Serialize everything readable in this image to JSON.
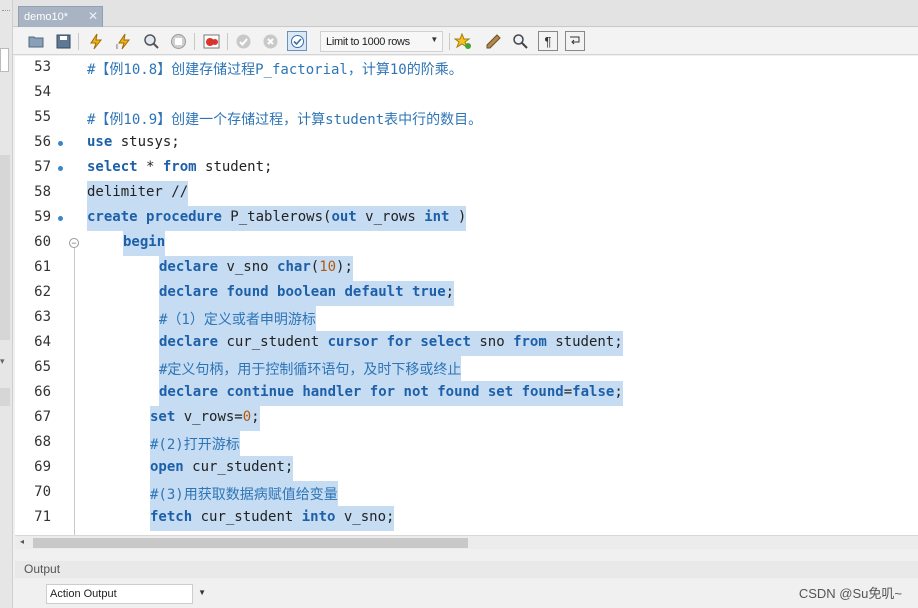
{
  "tab": {
    "title": "demo10*",
    "close": "✕"
  },
  "toolbar": {
    "limit_label": "Limit to 1000 rows",
    "limit_arrow": "▼"
  },
  "editor": {
    "lines": [
      {
        "num": "53",
        "marker": false,
        "segs": [
          {
            "t": "#【例10.8】创建存储过程P_factorial，计算10的阶乘。",
            "c": "comment"
          }
        ]
      },
      {
        "num": "54",
        "marker": false,
        "segs": []
      },
      {
        "num": "55",
        "marker": false,
        "segs": [
          {
            "t": "#【例10.9】创建一个存储过程，计算student表中行的数目。",
            "c": "comment"
          }
        ]
      },
      {
        "num": "56",
        "marker": true,
        "segs": [
          {
            "t": "use",
            "c": "kw"
          },
          {
            "t": " stusys;"
          }
        ]
      },
      {
        "num": "57",
        "marker": true,
        "segs": [
          {
            "t": "select",
            "c": "kw"
          },
          {
            "t": " * "
          },
          {
            "t": "from",
            "c": "kw"
          },
          {
            "t": " student;"
          }
        ]
      },
      {
        "num": "58",
        "marker": false,
        "sel": true,
        "segs": [
          {
            "t": "delimiter //"
          }
        ]
      },
      {
        "num": "59",
        "marker": true,
        "sel": true,
        "segs": [
          {
            "t": "create",
            "c": "kw"
          },
          {
            "t": " "
          },
          {
            "t": "procedure",
            "c": "kw"
          },
          {
            "t": " P_tablerows("
          },
          {
            "t": "out",
            "c": "kw"
          },
          {
            "t": " v_rows "
          },
          {
            "t": "int",
            "c": "kw"
          },
          {
            "t": " )"
          }
        ]
      },
      {
        "num": "60",
        "marker": false,
        "fold": true,
        "sel": true,
        "indent": 36,
        "segs": [
          {
            "t": "begin",
            "c": "kw"
          }
        ]
      },
      {
        "num": "61",
        "marker": false,
        "sel": true,
        "indent": 72,
        "segs": [
          {
            "t": "declare",
            "c": "kw"
          },
          {
            "t": " v_sno "
          },
          {
            "t": "char",
            "c": "kw"
          },
          {
            "t": "("
          },
          {
            "t": "10",
            "c": "num"
          },
          {
            "t": ");"
          }
        ]
      },
      {
        "num": "62",
        "marker": false,
        "sel": true,
        "indent": 72,
        "segs": [
          {
            "t": "declare",
            "c": "kw"
          },
          {
            "t": " "
          },
          {
            "t": "found",
            "c": "kw"
          },
          {
            "t": " "
          },
          {
            "t": "boolean",
            "c": "kw"
          },
          {
            "t": " "
          },
          {
            "t": "default",
            "c": "kw"
          },
          {
            "t": " "
          },
          {
            "t": "true",
            "c": "kw"
          },
          {
            "t": ";"
          }
        ]
      },
      {
        "num": "63",
        "marker": false,
        "sel": true,
        "indent": 72,
        "segs": [
          {
            "t": "#（1）定义或者申明游标",
            "c": "comment"
          }
        ]
      },
      {
        "num": "64",
        "marker": false,
        "sel": true,
        "indent": 72,
        "segs": [
          {
            "t": "declare",
            "c": "kw"
          },
          {
            "t": " cur_student "
          },
          {
            "t": "cursor",
            "c": "kw"
          },
          {
            "t": " "
          },
          {
            "t": "for",
            "c": "kw"
          },
          {
            "t": " "
          },
          {
            "t": "select",
            "c": "kw"
          },
          {
            "t": " sno "
          },
          {
            "t": "from",
            "c": "kw"
          },
          {
            "t": " student;"
          }
        ]
      },
      {
        "num": "65",
        "marker": false,
        "sel": true,
        "indent": 72,
        "segs": [
          {
            "t": "#定义句柄，用于控制循环语句，及时下移或终止",
            "c": "comment"
          }
        ]
      },
      {
        "num": "66",
        "marker": false,
        "sel": true,
        "indent": 72,
        "segs": [
          {
            "t": "declare",
            "c": "kw"
          },
          {
            "t": " "
          },
          {
            "t": "continue",
            "c": "kw"
          },
          {
            "t": " "
          },
          {
            "t": "handler",
            "c": "kw"
          },
          {
            "t": " "
          },
          {
            "t": "for",
            "c": "kw"
          },
          {
            "t": " "
          },
          {
            "t": "not",
            "c": "kw"
          },
          {
            "t": " "
          },
          {
            "t": "found",
            "c": "kw"
          },
          {
            "t": " "
          },
          {
            "t": "set",
            "c": "kw"
          },
          {
            "t": " "
          },
          {
            "t": "found",
            "c": "kw"
          },
          {
            "t": "="
          },
          {
            "t": "false",
            "c": "kw"
          },
          {
            "t": ";"
          }
        ]
      },
      {
        "num": "67",
        "marker": false,
        "sel": true,
        "indent": 63,
        "segs": [
          {
            "t": "set",
            "c": "kw"
          },
          {
            "t": " v_rows="
          },
          {
            "t": "0",
            "c": "num"
          },
          {
            "t": ";"
          }
        ]
      },
      {
        "num": "68",
        "marker": false,
        "sel": true,
        "indent": 63,
        "segs": [
          {
            "t": "#(2)打开游标",
            "c": "comment"
          }
        ]
      },
      {
        "num": "69",
        "marker": false,
        "sel": true,
        "indent": 63,
        "segs": [
          {
            "t": "open",
            "c": "kw"
          },
          {
            "t": " cur_student;"
          }
        ]
      },
      {
        "num": "70",
        "marker": false,
        "sel": true,
        "indent": 63,
        "segs": [
          {
            "t": "#(3)用获取数据病赋值给变量",
            "c": "comment"
          }
        ]
      },
      {
        "num": "71",
        "marker": false,
        "sel": true,
        "indent": 63,
        "segs": [
          {
            "t": "fetch",
            "c": "kw"
          },
          {
            "t": " cur_student "
          },
          {
            "t": "into",
            "c": "kw"
          },
          {
            "t": " v_sno;"
          }
        ]
      }
    ]
  },
  "output": {
    "header": "Output",
    "selected": "Action Output",
    "arrow": "▼"
  },
  "watermark": "CSDN @Su免叽~",
  "icons": [
    "open-folder-icon",
    "save-icon",
    "execute-icon",
    "execute-current-icon",
    "explain-icon",
    "stop-icon",
    "toggle-error-icon",
    "commit-icon",
    "rollback-icon",
    "autocommit-icon",
    "beautify-icon",
    "find-icon",
    "invisible-chars-icon",
    "wrap-icon",
    "bookmark-icon"
  ]
}
